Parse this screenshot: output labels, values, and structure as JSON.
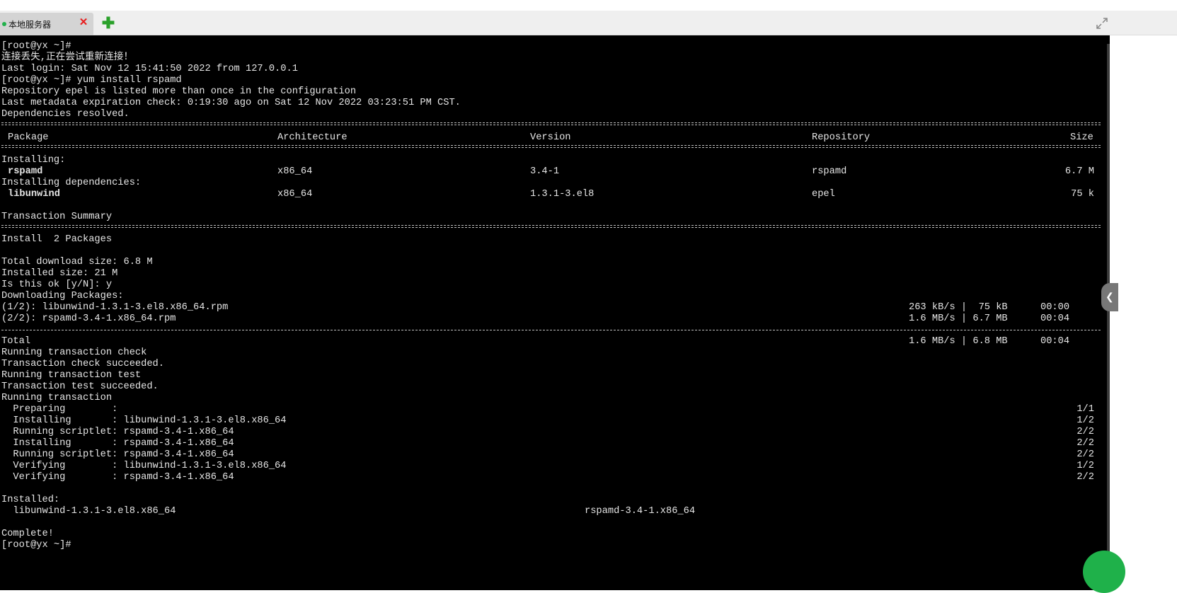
{
  "tab": {
    "label": "本地服务器",
    "close_glyph": "✕",
    "add_glyph": "✚"
  },
  "terminal": {
    "lines_top": [
      "[root@yx ~]#",
      "连接丢失,正在尝试重新连接！",
      "Last login: Sat Nov 12 15:41:50 2022 from 127.0.0.1",
      "[root@yx ~]# yum install rspamd",
      "Repository epel is listed more than once in the configuration",
      "Last metadata expiration check: 0:19:30 ago on Sat 12 Nov 2022 03:23:51 PM CST.",
      "Dependencies resolved."
    ],
    "table_header": {
      "package": "Package",
      "arch": "Architecture",
      "version": "Version",
      "repo": "Repository",
      "size": "Size"
    },
    "installing_label": "Installing:",
    "deps_label": "Installing dependencies:",
    "packages": [
      {
        "name": "rspamd",
        "arch": "x86_64",
        "version": "3.4-1",
        "repo": "rspamd",
        "size": "6.7 M"
      },
      {
        "name": "libunwind",
        "arch": "x86_64",
        "version": "1.3.1-3.el8",
        "repo": "epel",
        "size": "75 k"
      }
    ],
    "transaction_summary": "Transaction Summary",
    "install_count": "Install  2 Packages",
    "download_lines": [
      "Total download size: 6.8 M",
      "Installed size: 21 M",
      "Is this ok [y/N]: y",
      "Downloading Packages:"
    ],
    "downloads": [
      {
        "file": "(1/2): libunwind-1.3.1-3.el8.x86_64.rpm",
        "speed": "263 kB/s |  75 kB",
        "time": "00:00"
      },
      {
        "file": "(2/2): rspamd-3.4-1.x86_64.rpm",
        "speed": "1.6 MB/s | 6.7 MB",
        "time": "00:04"
      }
    ],
    "total": {
      "label": "Total",
      "speed": "1.6 MB/s | 6.8 MB",
      "time": "00:04"
    },
    "transaction_lines": [
      "Running transaction check",
      "Transaction check succeeded.",
      "Running transaction test",
      "Transaction test succeeded.",
      "Running transaction"
    ],
    "steps": [
      {
        "text": "  Preparing        :",
        "count": "1/1"
      },
      {
        "text": "  Installing       : libunwind-1.3.1-3.el8.x86_64",
        "count": "1/2"
      },
      {
        "text": "  Running scriptlet: rspamd-3.4-1.x86_64",
        "count": "2/2"
      },
      {
        "text": "  Installing       : rspamd-3.4-1.x86_64",
        "count": "2/2"
      },
      {
        "text": "  Running scriptlet: rspamd-3.4-1.x86_64",
        "count": "2/2"
      },
      {
        "text": "  Verifying        : libunwind-1.3.1-3.el8.x86_64",
        "count": "1/2"
      },
      {
        "text": "  Verifying        : rspamd-3.4-1.x86_64",
        "count": "2/2"
      }
    ],
    "installed_label": "Installed:",
    "installed": [
      "  libunwind-1.3.1-3.el8.x86_64",
      "rspamd-3.4-1.x86_64"
    ],
    "complete": "Complete!",
    "prompt": "[root@yx ~]#"
  },
  "colors": {
    "terminal_bg": "#000000",
    "text": "#e6e6e6",
    "package_green": "#7ddb3a",
    "close_red": "#e81c1c",
    "add_green": "#2aa12a"
  },
  "icons": {
    "expand": "expand-icon",
    "close": "close-icon",
    "add": "plus-icon",
    "status": "connected-dot-icon"
  }
}
